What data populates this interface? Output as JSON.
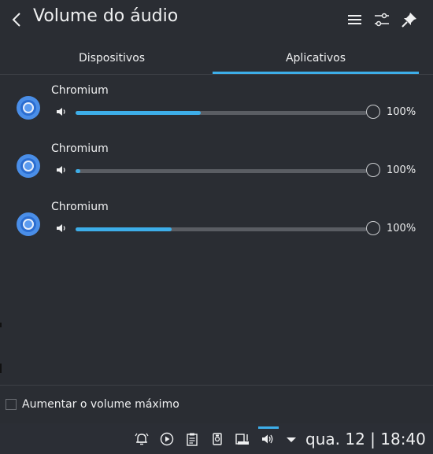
{
  "header": {
    "title": "Volume do áudio",
    "icons": [
      "back-arrow-icon",
      "menu-icon",
      "settings-sliders-icon",
      "pin-icon"
    ]
  },
  "tabs": [
    {
      "label": "Dispositivos",
      "active": false
    },
    {
      "label": "Aplicativos",
      "active": true
    }
  ],
  "apps": [
    {
      "name": "Chromium",
      "volume_label": "100%",
      "level": 0.43
    },
    {
      "name": "Chromium",
      "volume_label": "100%",
      "level": 0.01
    },
    {
      "name": "Chromium",
      "volume_label": "100%",
      "level": 0.33
    }
  ],
  "footer": {
    "raise_max_volume_label": "Aumentar o volume máximo",
    "raise_max_volume_checked": false
  },
  "taskbar": {
    "clock": "qua. 12 | 18:40",
    "icons": [
      "alarm-icon",
      "media-play-icon",
      "clipboard-icon",
      "usb-device-icon",
      "network-icon",
      "volume-icon",
      "expand-tray-arrow-icon"
    ]
  },
  "colors": {
    "accent": "#3daee9",
    "background": "#2a2d33",
    "track": "#5a5d63",
    "text": "#eff0f1"
  }
}
